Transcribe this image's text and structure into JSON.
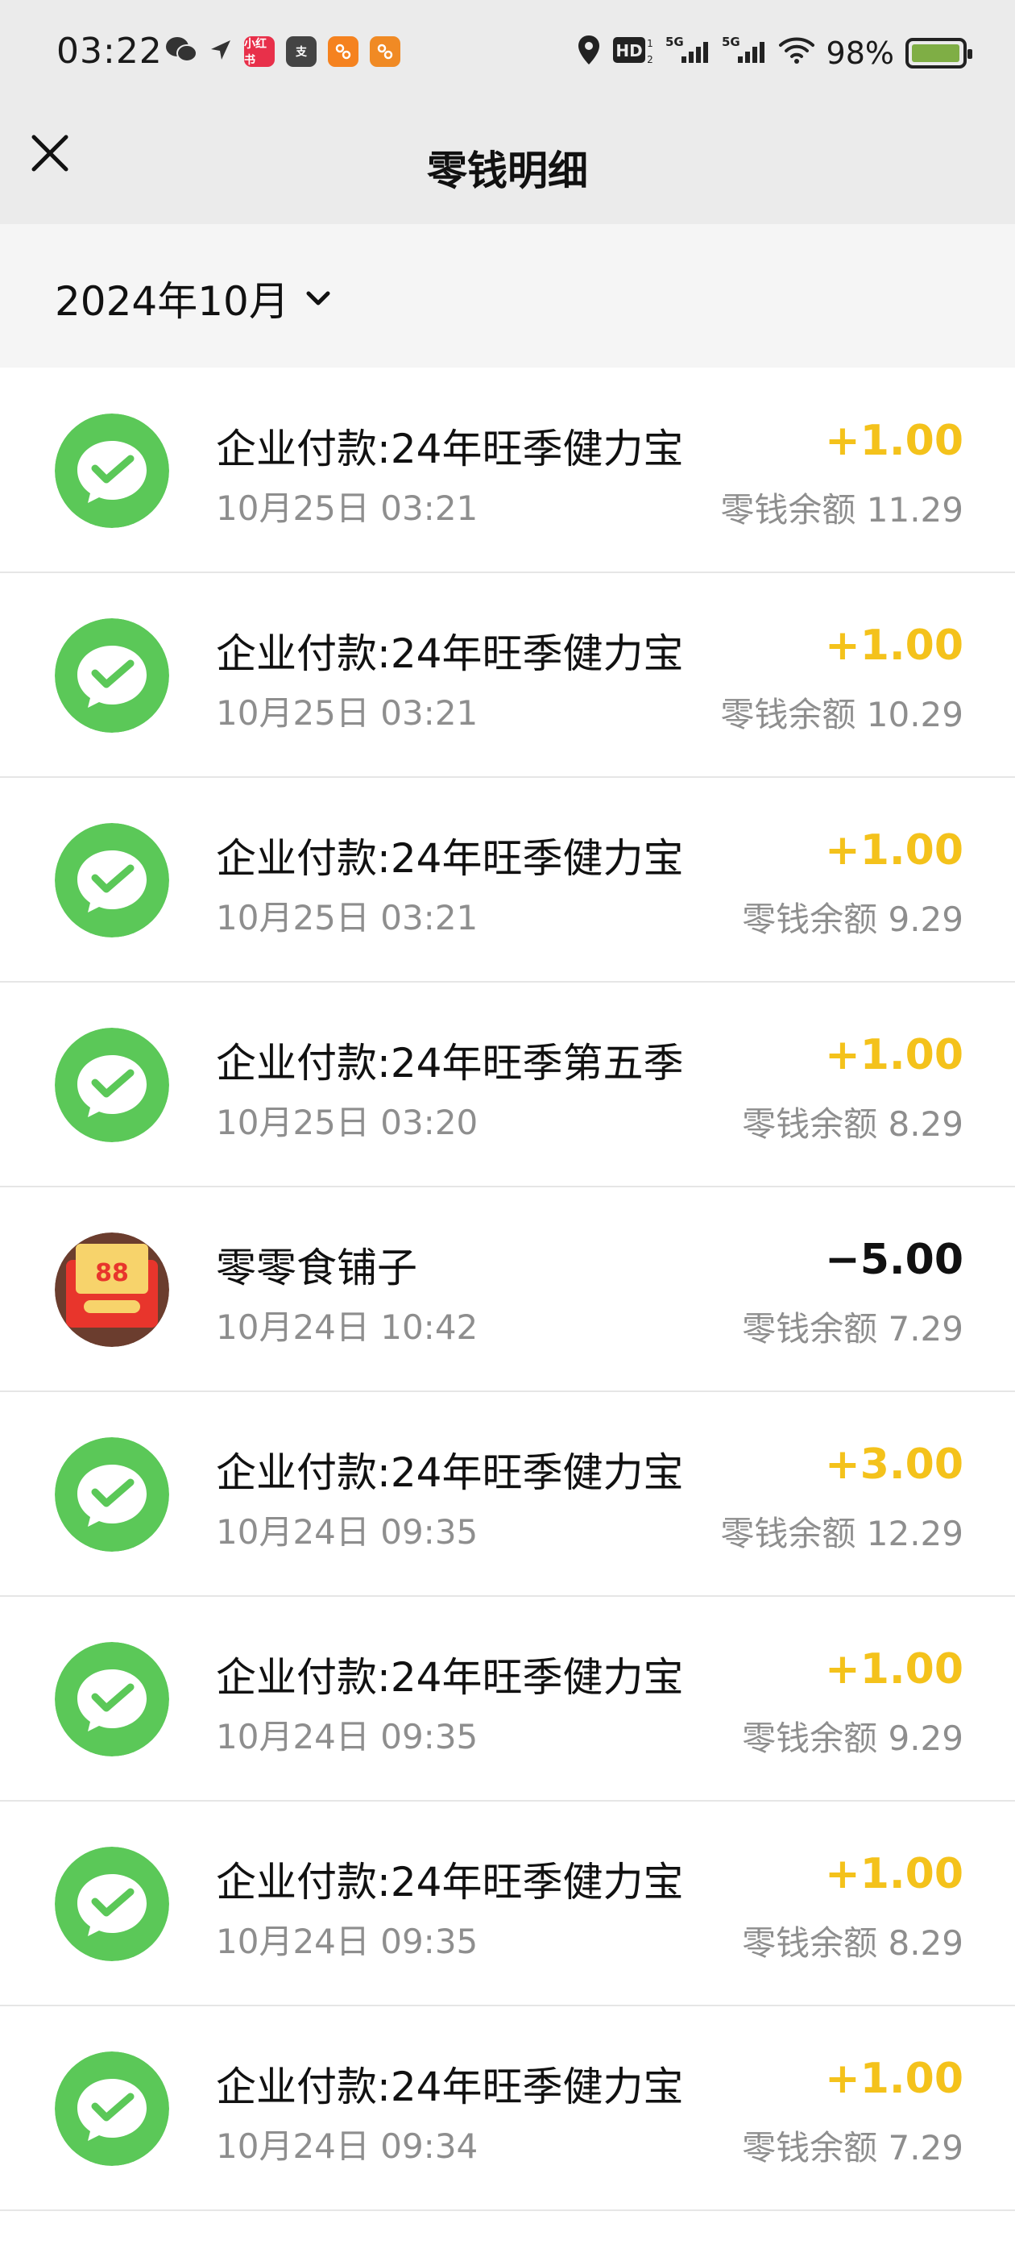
{
  "status_bar": {
    "time": "03:22",
    "battery_percent": "98%",
    "battery_level": 0.98,
    "left_icons": [
      {
        "name": "wechat-icon"
      },
      {
        "name": "location-arrow-icon"
      },
      {
        "name": "app-xiaohongshu-icon",
        "label": "小红书",
        "color": "#e8304a"
      },
      {
        "name": "app-zhifubao-icon",
        "label": "支",
        "color": "#444444"
      },
      {
        "name": "app-orange-icon",
        "label": "",
        "color": "#f5821f"
      },
      {
        "name": "app-orange-rounded-icon",
        "label": "",
        "color": "#f08a24"
      }
    ]
  },
  "header": {
    "title": "零钱明细"
  },
  "filter": {
    "month": "2024年10月"
  },
  "colors": {
    "income": "#f4c21b",
    "wechat_green": "#5bc858"
  },
  "transactions": [
    {
      "title": "企业付款:24年旺季健力宝",
      "time": "10月25日 03:21",
      "amount": "+1.00",
      "balance": "零钱余额 11.29",
      "type": "income",
      "icon": "wechat-pay-icon"
    },
    {
      "title": "企业付款:24年旺季健力宝",
      "time": "10月25日 03:21",
      "amount": "+1.00",
      "balance": "零钱余额 10.29",
      "type": "income",
      "icon": "wechat-pay-icon"
    },
    {
      "title": "企业付款:24年旺季健力宝",
      "time": "10月25日 03:21",
      "amount": "+1.00",
      "balance": "零钱余额 9.29",
      "type": "income",
      "icon": "wechat-pay-icon"
    },
    {
      "title": "企业付款:24年旺季第五季",
      "time": "10月25日 03:20",
      "amount": "+1.00",
      "balance": "零钱余额 8.29",
      "type": "income",
      "icon": "wechat-pay-icon"
    },
    {
      "title": "零零食铺子",
      "time": "10月24日 10:42",
      "amount": "−5.00",
      "balance": "零钱余额 7.29",
      "type": "expense",
      "icon": "red-packet-avatar",
      "avatar_number": "88"
    },
    {
      "title": "企业付款:24年旺季健力宝",
      "time": "10月24日 09:35",
      "amount": "+3.00",
      "balance": "零钱余额 12.29",
      "type": "income",
      "icon": "wechat-pay-icon"
    },
    {
      "title": "企业付款:24年旺季健力宝",
      "time": "10月24日 09:35",
      "amount": "+1.00",
      "balance": "零钱余额 9.29",
      "type": "income",
      "icon": "wechat-pay-icon"
    },
    {
      "title": "企业付款:24年旺季健力宝",
      "time": "10月24日 09:35",
      "amount": "+1.00",
      "balance": "零钱余额 8.29",
      "type": "income",
      "icon": "wechat-pay-icon"
    },
    {
      "title": "企业付款:24年旺季健力宝",
      "time": "10月24日 09:34",
      "amount": "+1.00",
      "balance": "零钱余额 7.29",
      "type": "income",
      "icon": "wechat-pay-icon"
    }
  ]
}
